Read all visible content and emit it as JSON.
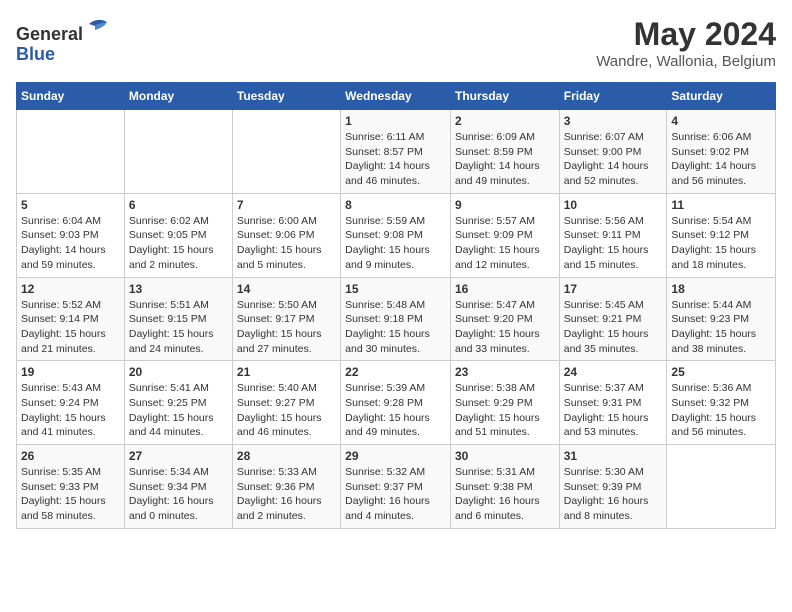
{
  "header": {
    "logo_line1": "General",
    "logo_line2": "Blue",
    "title": "May 2024",
    "subtitle": "Wandre, Wallonia, Belgium"
  },
  "weekdays": [
    "Sunday",
    "Monday",
    "Tuesday",
    "Wednesday",
    "Thursday",
    "Friday",
    "Saturday"
  ],
  "weeks": [
    [
      {
        "day": "",
        "info": ""
      },
      {
        "day": "",
        "info": ""
      },
      {
        "day": "",
        "info": ""
      },
      {
        "day": "1",
        "info": "Sunrise: 6:11 AM\nSunset: 8:57 PM\nDaylight: 14 hours and 46 minutes."
      },
      {
        "day": "2",
        "info": "Sunrise: 6:09 AM\nSunset: 8:59 PM\nDaylight: 14 hours and 49 minutes."
      },
      {
        "day": "3",
        "info": "Sunrise: 6:07 AM\nSunset: 9:00 PM\nDaylight: 14 hours and 52 minutes."
      },
      {
        "day": "4",
        "info": "Sunrise: 6:06 AM\nSunset: 9:02 PM\nDaylight: 14 hours and 56 minutes."
      }
    ],
    [
      {
        "day": "5",
        "info": "Sunrise: 6:04 AM\nSunset: 9:03 PM\nDaylight: 14 hours and 59 minutes."
      },
      {
        "day": "6",
        "info": "Sunrise: 6:02 AM\nSunset: 9:05 PM\nDaylight: 15 hours and 2 minutes."
      },
      {
        "day": "7",
        "info": "Sunrise: 6:00 AM\nSunset: 9:06 PM\nDaylight: 15 hours and 5 minutes."
      },
      {
        "day": "8",
        "info": "Sunrise: 5:59 AM\nSunset: 9:08 PM\nDaylight: 15 hours and 9 minutes."
      },
      {
        "day": "9",
        "info": "Sunrise: 5:57 AM\nSunset: 9:09 PM\nDaylight: 15 hours and 12 minutes."
      },
      {
        "day": "10",
        "info": "Sunrise: 5:56 AM\nSunset: 9:11 PM\nDaylight: 15 hours and 15 minutes."
      },
      {
        "day": "11",
        "info": "Sunrise: 5:54 AM\nSunset: 9:12 PM\nDaylight: 15 hours and 18 minutes."
      }
    ],
    [
      {
        "day": "12",
        "info": "Sunrise: 5:52 AM\nSunset: 9:14 PM\nDaylight: 15 hours and 21 minutes."
      },
      {
        "day": "13",
        "info": "Sunrise: 5:51 AM\nSunset: 9:15 PM\nDaylight: 15 hours and 24 minutes."
      },
      {
        "day": "14",
        "info": "Sunrise: 5:50 AM\nSunset: 9:17 PM\nDaylight: 15 hours and 27 minutes."
      },
      {
        "day": "15",
        "info": "Sunrise: 5:48 AM\nSunset: 9:18 PM\nDaylight: 15 hours and 30 minutes."
      },
      {
        "day": "16",
        "info": "Sunrise: 5:47 AM\nSunset: 9:20 PM\nDaylight: 15 hours and 33 minutes."
      },
      {
        "day": "17",
        "info": "Sunrise: 5:45 AM\nSunset: 9:21 PM\nDaylight: 15 hours and 35 minutes."
      },
      {
        "day": "18",
        "info": "Sunrise: 5:44 AM\nSunset: 9:23 PM\nDaylight: 15 hours and 38 minutes."
      }
    ],
    [
      {
        "day": "19",
        "info": "Sunrise: 5:43 AM\nSunset: 9:24 PM\nDaylight: 15 hours and 41 minutes."
      },
      {
        "day": "20",
        "info": "Sunrise: 5:41 AM\nSunset: 9:25 PM\nDaylight: 15 hours and 44 minutes."
      },
      {
        "day": "21",
        "info": "Sunrise: 5:40 AM\nSunset: 9:27 PM\nDaylight: 15 hours and 46 minutes."
      },
      {
        "day": "22",
        "info": "Sunrise: 5:39 AM\nSunset: 9:28 PM\nDaylight: 15 hours and 49 minutes."
      },
      {
        "day": "23",
        "info": "Sunrise: 5:38 AM\nSunset: 9:29 PM\nDaylight: 15 hours and 51 minutes."
      },
      {
        "day": "24",
        "info": "Sunrise: 5:37 AM\nSunset: 9:31 PM\nDaylight: 15 hours and 53 minutes."
      },
      {
        "day": "25",
        "info": "Sunrise: 5:36 AM\nSunset: 9:32 PM\nDaylight: 15 hours and 56 minutes."
      }
    ],
    [
      {
        "day": "26",
        "info": "Sunrise: 5:35 AM\nSunset: 9:33 PM\nDaylight: 15 hours and 58 minutes."
      },
      {
        "day": "27",
        "info": "Sunrise: 5:34 AM\nSunset: 9:34 PM\nDaylight: 16 hours and 0 minutes."
      },
      {
        "day": "28",
        "info": "Sunrise: 5:33 AM\nSunset: 9:36 PM\nDaylight: 16 hours and 2 minutes."
      },
      {
        "day": "29",
        "info": "Sunrise: 5:32 AM\nSunset: 9:37 PM\nDaylight: 16 hours and 4 minutes."
      },
      {
        "day": "30",
        "info": "Sunrise: 5:31 AM\nSunset: 9:38 PM\nDaylight: 16 hours and 6 minutes."
      },
      {
        "day": "31",
        "info": "Sunrise: 5:30 AM\nSunset: 9:39 PM\nDaylight: 16 hours and 8 minutes."
      },
      {
        "day": "",
        "info": ""
      }
    ]
  ]
}
